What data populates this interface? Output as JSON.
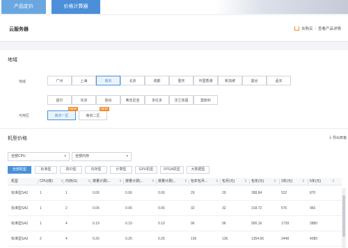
{
  "tabs": [
    {
      "label": "产品定价"
    },
    {
      "label": "价格计算器"
    }
  ],
  "header": {
    "title": "云服务器",
    "cart_label": "去购买",
    "detail_label": "查看产品详情",
    "separator": "|"
  },
  "region": {
    "title": "地域",
    "area_label": "地域",
    "zone_label": "可用区",
    "cities_row1": [
      "广州",
      "上海",
      "南京",
      "北京",
      "成都",
      "重庆",
      "中国香港",
      "新加坡",
      "曼谷",
      "孟买"
    ],
    "cities_row2": [
      "首尔",
      "东京",
      "硅谷",
      "弗吉尼亚",
      "多伦多",
      "法兰克福",
      "莫斯科"
    ],
    "selected_city": "南京",
    "zones": [
      {
        "label": "南京一区",
        "badge": "NEW"
      },
      {
        "label": "南京二区",
        "badge": "NEW"
      }
    ],
    "selected_zone": "南京一区"
  },
  "pricing": {
    "title": "机型价格",
    "export_label": "导出表格",
    "cpu_select": "全部CPU",
    "mem_select": "全部内存",
    "categories": [
      "全部机型",
      "标准型",
      "高IO型",
      "内存型",
      "计算型",
      "GPU机型",
      "FPGA机型",
      "大数据型"
    ],
    "selected_category": "全部机型",
    "columns": [
      "机型",
      "CPU(核)",
      "内存(G)",
      "按量计费(...",
      "按量计费(...",
      "按量计费(...",
      "包年包月...",
      "包月(元)",
      "包年(元)",
      "3年(元)",
      "5年(元)"
    ],
    "rows": [
      [
        "标准型SA2",
        "1",
        "1",
        "0.06",
        "0.06",
        "0.06",
        "29",
        "29",
        "288.84",
        "522",
        "870"
      ],
      [
        "标准型SA2",
        "1",
        "2",
        "0.06",
        "0.06",
        "0.06",
        "32",
        "32",
        "318.72",
        "576",
        "960"
      ],
      [
        "标准型SA2",
        "1",
        "4",
        "0.19",
        "0.19",
        "0.19",
        "96",
        "96",
        "956.16",
        "1728",
        "2880"
      ],
      [
        "标准型SA2",
        "2",
        "4",
        "0.26",
        "0.26",
        "0.26",
        "136",
        "136",
        "1354.56",
        "2448",
        "4080"
      ]
    ]
  },
  "icons": {
    "cart": "cart-icon",
    "download": "download-icon",
    "caret": "chevron-down-icon"
  }
}
